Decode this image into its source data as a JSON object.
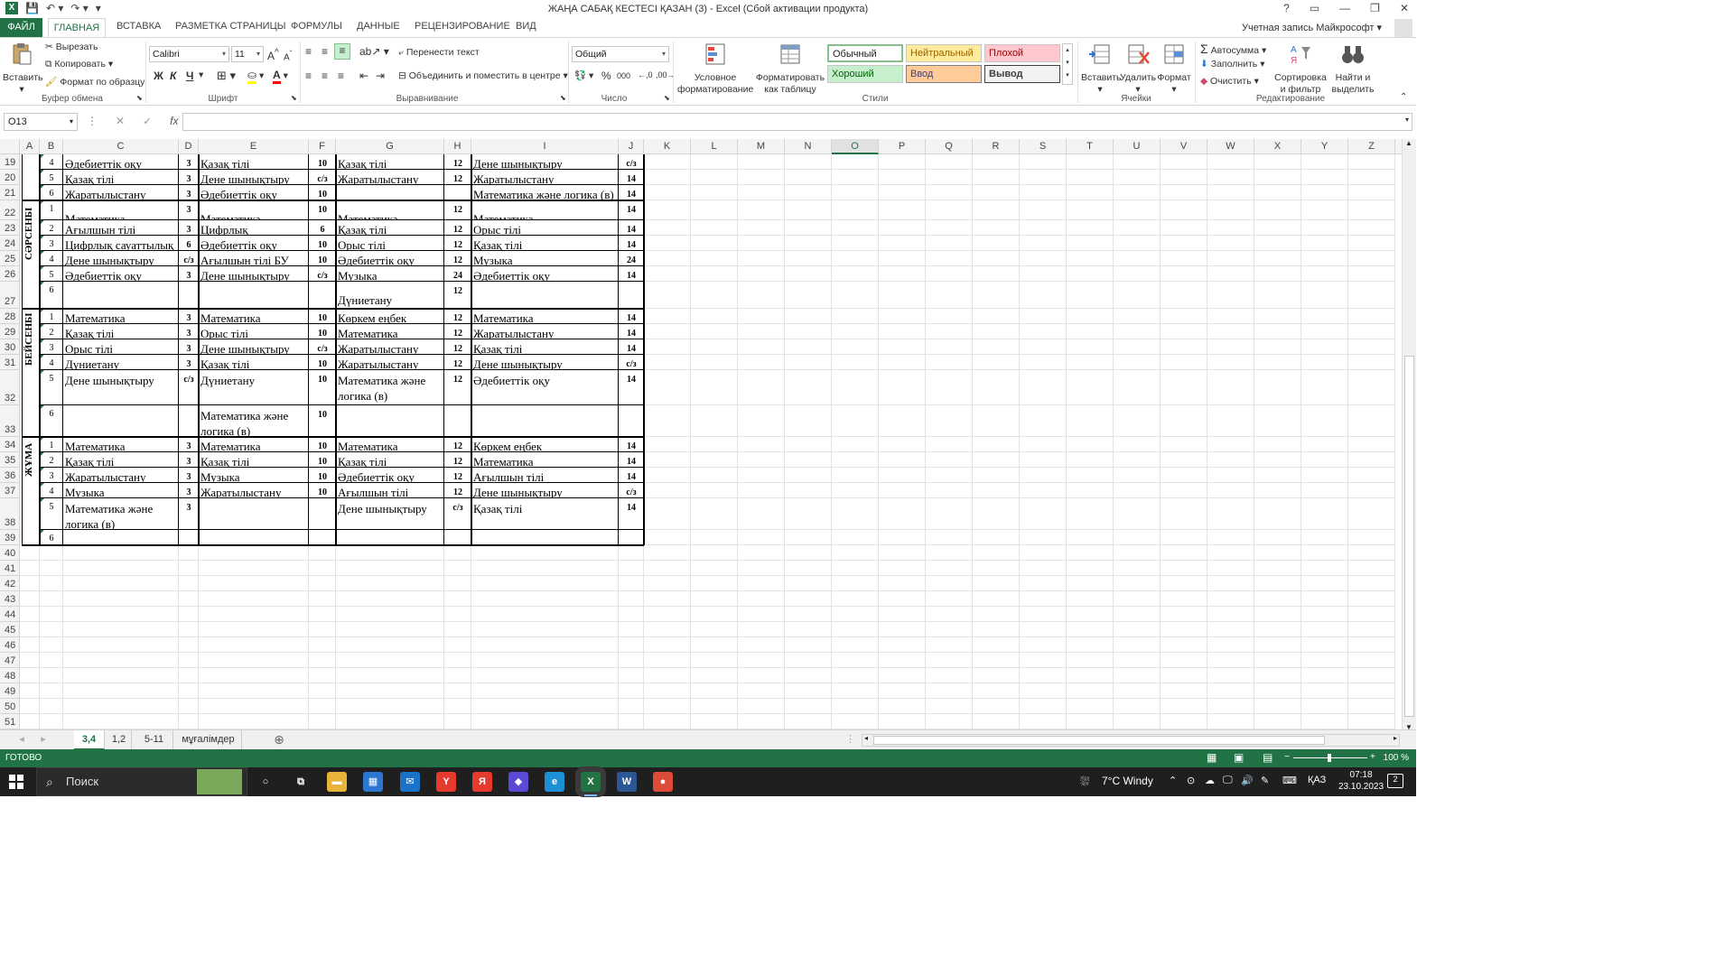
{
  "window": {
    "title": "ЖАҢА САБАҚ КЕСТЕСІ ҚАЗАН (3) - Excel (Сбой активации продукта)",
    "account": "Учетная запись Майкрософт",
    "ctrl_help": "?",
    "ctrl_min": "—",
    "ctrl_restore": "❐",
    "ctrl_close": "✕"
  },
  "tabs": {
    "file": "ФАЙЛ",
    "home": "ГЛАВНАЯ",
    "insert": "ВСТАВКА",
    "layout": "РАЗМЕТКА СТРАНИЦЫ",
    "formulas": "ФОРМУЛЫ",
    "data": "ДАННЫЕ",
    "review": "РЕЦЕНЗИРОВАНИЕ",
    "view": "ВИД"
  },
  "ribbon": {
    "clipboard": {
      "paste": "Вставить",
      "cut": "Вырезать",
      "copy": "Копировать",
      "format_painter": "Формат по образцу",
      "label": "Буфер обмена"
    },
    "font": {
      "name": "Calibri",
      "size": "11",
      "bold": "Ж",
      "italic": "К",
      "underline": "Ч",
      "label": "Шрифт"
    },
    "alignment": {
      "wrap": "Перенести текст",
      "merge": "Объединить и поместить в центре",
      "label": "Выравнивание"
    },
    "number": {
      "format": "Общий",
      "percent": "%",
      "thousands": "000",
      "label": "Число"
    },
    "styles": {
      "conditional": "Условное форматирование",
      "as_table": "Форматировать как таблицу",
      "normal": "Обычный",
      "neutral": "Нейтральный",
      "bad": "Плохой",
      "good": "Хороший",
      "input": "Ввод",
      "output": "Вывод",
      "label": "Стили"
    },
    "cells": {
      "insert": "Вставить",
      "delete": "Удалить",
      "format": "Формат",
      "label": "Ячейки"
    },
    "editing": {
      "autosum": "Автосумма",
      "fill": "Заполнить",
      "clear": "Очистить",
      "sort": "Сортировка и фильтр",
      "find": "Найти и выделить",
      "label": "Редактирование"
    }
  },
  "formula_bar": {
    "namebox": "O13",
    "cancel": "✕",
    "enter": "✓",
    "fx": "fx",
    "value": ""
  },
  "columns": [
    "A",
    "B",
    "C",
    "D",
    "E",
    "F",
    "G",
    "H",
    "I",
    "J",
    "K",
    "L",
    "M",
    "N",
    "O",
    "P",
    "Q",
    "R",
    "S",
    "T",
    "U",
    "V",
    "W",
    "X",
    "Y",
    "Z"
  ],
  "selected_column": "O",
  "rows": [
    "19",
    "20",
    "21",
    "22",
    "23",
    "24",
    "25",
    "26",
    "27",
    "28",
    "29",
    "30",
    "31",
    "32",
    "33",
    "34",
    "35",
    "36",
    "37",
    "38",
    "39",
    "40",
    "41",
    "42",
    "43",
    "44",
    "45",
    "46",
    "47",
    "48",
    "49",
    "50",
    "51"
  ],
  "days": {
    "wednesday": "СӘРСЕНБІ",
    "thursday": "БЕЙСЕНБІ",
    "friday": "ЖҰМА"
  },
  "table": [
    {
      "n": "4",
      "c": "Әдебиеттік оқу",
      "d": "3",
      "e": "Қазақ тілі",
      "f": "10",
      "g": "Қазақ тілі",
      "h": "12",
      "i": "Дене шынықтыру",
      "j": "с/з"
    },
    {
      "n": "5",
      "c": "Қазақ тілі",
      "d": "3",
      "e": "Дене шынықтыру",
      "f": "с/з",
      "g": "Жаратылыстану",
      "h": "12",
      "i": "Жаратылыстану",
      "j": "14"
    },
    {
      "n": "6",
      "c": "Жаратылыстану",
      "d": "3",
      "e": "Әдебиеттік оқу",
      "f": "10",
      "g": "",
      "h": "",
      "i": "Математика және логика (в)",
      "j": "14"
    },
    {
      "n": "1",
      "c": "Математика",
      "d": "3",
      "e": "Математика",
      "f": "10",
      "g": "Математика",
      "h": "12",
      "i": "Математика",
      "j": "14"
    },
    {
      "n": "2",
      "c": "Ағылшын тілі",
      "d": "3",
      "e": "Цифрлық сауаттылық",
      "f": "6",
      "g": "Қазақ тілі",
      "h": "12",
      "i": "Орыс тілі",
      "j": "14"
    },
    {
      "n": "3",
      "c": "Цифрлық сауаттылық",
      "d": "6",
      "e": "Әдебиеттік оқу",
      "f": "10",
      "g": "Орыс тілі",
      "h": "12",
      "i": "Қазақ тілі",
      "j": "14"
    },
    {
      "n": "4",
      "c": "Дене шынықтыру",
      "d": "с/з",
      "e": "Ағылшын тілі БУ",
      "f": "10",
      "g": "Әдебиеттік оқу",
      "h": "12",
      "i": "Музыка",
      "j": "24"
    },
    {
      "n": "5",
      "c": "Әдебиеттік оқу",
      "d": "3",
      "e": "Дене шынықтыру",
      "f": "с/з",
      "g": "Музыка",
      "h": "24",
      "i": "Әдебиеттік оқу",
      "j": "14"
    },
    {
      "n": "6",
      "c": "",
      "d": "",
      "e": "",
      "f": "",
      "g": "Дүниетану",
      "h": "12",
      "i": "",
      "j": ""
    },
    {
      "n": "1",
      "c": "Математика",
      "d": "3",
      "e": "Математика",
      "f": "10",
      "g": "Көркем еңбек",
      "h": "12",
      "i": "Математика",
      "j": "14"
    },
    {
      "n": "2",
      "c": "Қазақ тілі",
      "d": "3",
      "e": "Орыс тілі",
      "f": "10",
      "g": "Математика",
      "h": "12",
      "i": "Жаратылыстану",
      "j": "14"
    },
    {
      "n": "3",
      "c": "Орыс тілі",
      "d": "3",
      "e": "Дене шынықтыру",
      "f": "с/з",
      "g": "Жаратылыстану",
      "h": "12",
      "i": "Қазақ тілі",
      "j": "14"
    },
    {
      "n": "4",
      "c": "Дүниетану",
      "d": "3",
      "e": "Қазақ тілі",
      "f": "10",
      "g": "Жаратылыстану",
      "h": "12",
      "i": "Дене шынықтыру",
      "j": "с/з"
    },
    {
      "n": "5",
      "c": "Дене шынықтыру",
      "d": "с/з",
      "e": "Дүниетану",
      "f": "10",
      "g": "Математика және логика (в)",
      "h": "12",
      "i": "Әдебиеттік оқу",
      "j": "14"
    },
    {
      "n": "6",
      "c": "",
      "d": "",
      "e": "Математика және логика (в)",
      "f": "10",
      "g": "",
      "h": "",
      "i": "",
      "j": ""
    },
    {
      "n": "1",
      "c": "Математика",
      "d": "3",
      "e": "Математика",
      "f": "10",
      "g": "Математика",
      "h": "12",
      "i": "Көркем еңбек",
      "j": "14"
    },
    {
      "n": "2",
      "c": "Қазақ тілі",
      "d": "3",
      "e": "Қазақ тілі",
      "f": "10",
      "g": "Қазақ тілі",
      "h": "12",
      "i": "Математика",
      "j": "14"
    },
    {
      "n": "3",
      "c": "Жаратылыстану",
      "d": "3",
      "e": "Музыка",
      "f": "10",
      "g": "Әдебиеттік оқу",
      "h": "12",
      "i": "Ағылшын тілі",
      "j": "14"
    },
    {
      "n": "4",
      "c": "Музыка",
      "d": "3",
      "e": "Жаратылыстану",
      "f": "10",
      "g": "Ағылшын тілі",
      "h": "12",
      "i": "Дене шынықтыру",
      "j": "с/з"
    },
    {
      "n": "5",
      "c": "Математика және логика (в)",
      "d": "3",
      "e": "",
      "f": "",
      "g": "Дене шынықтыру",
      "h": "с/з",
      "i": "Қазақ тілі",
      "j": "14"
    },
    {
      "n": "6",
      "c": "",
      "d": "",
      "e": "",
      "f": "",
      "g": "",
      "h": "",
      "i": "",
      "j": ""
    }
  ],
  "sheets": [
    "3,4",
    "1,2",
    "5-11",
    "мұғалімдер"
  ],
  "active_sheet": "3,4",
  "add_sheet": "⊕",
  "status": {
    "ready": "ГОТОВО",
    "zoom": "100 %",
    "zoom_minus": "−",
    "zoom_plus": "+"
  },
  "taskbar": {
    "search": "Поиск",
    "weather": "7°C  Windy",
    "lang": "ҚАЗ",
    "time": "07:18",
    "date": "23.10.2023",
    "notifications": "2",
    "apps": [
      {
        "name": "cortana",
        "label": "○",
        "color": "#1f1f1f"
      },
      {
        "name": "taskview",
        "label": "⧉",
        "color": "#1f1f1f"
      },
      {
        "name": "explorer",
        "label": "▬",
        "color": "#e8b43a"
      },
      {
        "name": "store",
        "label": "▦",
        "color": "#2b76d2"
      },
      {
        "name": "mail",
        "label": "✉",
        "color": "#1a73c8"
      },
      {
        "name": "yandex-browser",
        "label": "Y",
        "color": "#e63a2e"
      },
      {
        "name": "yandex",
        "label": "Я",
        "color": "#e63a2e"
      },
      {
        "name": "app-blue",
        "label": "◆",
        "color": "#5b4ad6"
      },
      {
        "name": "edge",
        "label": "e",
        "color": "#1d8fd6"
      },
      {
        "name": "excel",
        "label": "X",
        "color": "#217346"
      },
      {
        "name": "word",
        "label": "W",
        "color": "#2b5797"
      },
      {
        "name": "chrome",
        "label": "●",
        "color": "#dd4b39"
      }
    ]
  },
  "colors": {
    "accent": "#217346",
    "neutral_bg": "#ffeb9c",
    "neutral_fg": "#9c6500",
    "bad_bg": "#ffc7ce",
    "bad_fg": "#9c0006",
    "good_bg": "#c6efce",
    "good_fg": "#006100",
    "input_bg": "#ffcc99",
    "input_fg": "#3f3f76",
    "output_bg": "#f2f2f2"
  }
}
